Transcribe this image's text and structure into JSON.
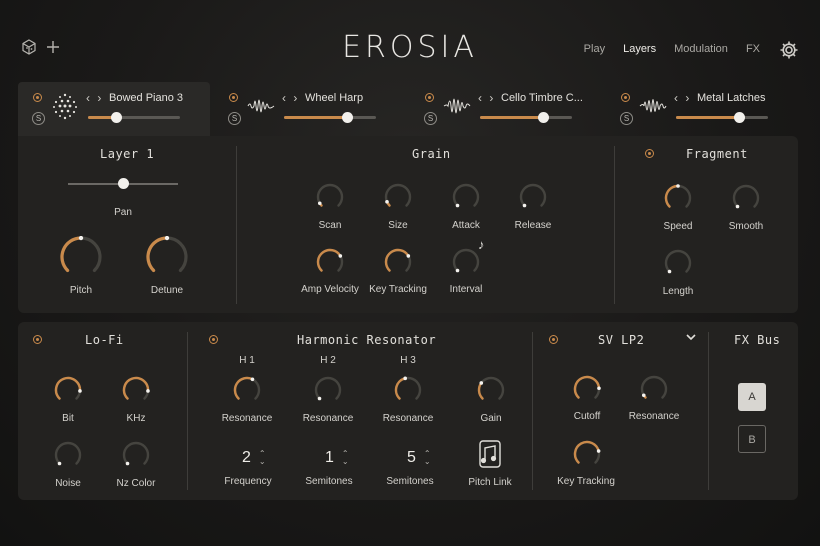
{
  "header": {
    "title": "EROSIA",
    "nav": [
      {
        "label": "Play",
        "active": false
      },
      {
        "label": "Layers",
        "active": true
      },
      {
        "label": "Modulation",
        "active": false
      },
      {
        "label": "FX",
        "active": false
      }
    ]
  },
  "layers": [
    {
      "name": "Bowed Piano 3",
      "level": 0.3,
      "active": true,
      "icon": "dots-sphere-icon"
    },
    {
      "name": "Wheel Harp",
      "level": 0.68,
      "active": false,
      "icon": "waveform-icon"
    },
    {
      "name": "Cello Timbre C...",
      "level": 0.68,
      "active": false,
      "icon": "waveform-icon"
    },
    {
      "name": "Metal Latches",
      "level": 0.68,
      "active": false,
      "icon": "waveform-icon"
    }
  ],
  "solo_label": "S",
  "layer_section": {
    "title": "Layer 1",
    "pan": {
      "label": "Pan",
      "value": 0.5
    },
    "knobs": [
      {
        "label": "Pitch",
        "value": 0.5
      },
      {
        "label": "Detune",
        "value": 0.5
      }
    ]
  },
  "grain": {
    "title": "Grain",
    "knobs": [
      {
        "label": "Scan",
        "value": 0.05
      },
      {
        "label": "Size",
        "value": 0.08
      },
      {
        "label": "Attack",
        "value": 0.0
      },
      {
        "label": "Release",
        "value": 0.0
      },
      {
        "label": "Amp Velocity",
        "value": 0.72
      },
      {
        "label": "Key Tracking",
        "value": 0.72
      },
      {
        "label": "Interval",
        "value": 0.0
      }
    ]
  },
  "fragment": {
    "title": "Fragment",
    "knobs": [
      {
        "label": "Speed",
        "value": 0.5
      },
      {
        "label": "Smooth",
        "value": 0.0
      },
      {
        "label": "Length",
        "value": 0.0
      }
    ]
  },
  "lofi": {
    "title": "Lo-Fi",
    "knobs": [
      {
        "label": "Bit",
        "value": 0.85
      },
      {
        "label": "KHz",
        "value": 0.85
      },
      {
        "label": "Noise",
        "value": 0.0
      },
      {
        "label": "Nz Color",
        "value": 0.0
      }
    ]
  },
  "resonator": {
    "title": "Harmonic Resonator",
    "harmonics": [
      "H 1",
      "H 2",
      "H 3"
    ],
    "knobs": [
      {
        "label": "Resonance",
        "value": 0.6
      },
      {
        "label": "Resonance",
        "value": 0.0
      },
      {
        "label": "Resonance",
        "value": 0.45
      },
      {
        "label": "Gain",
        "value": 0.3
      }
    ],
    "steppers": [
      {
        "label": "Frequency",
        "value": "2"
      },
      {
        "label": "Semitones",
        "value": "1"
      },
      {
        "label": "Semitones",
        "value": "5"
      }
    ],
    "pitch_link": "Pitch Link"
  },
  "filter": {
    "title": "SV LP2",
    "knobs": [
      {
        "label": "Cutoff",
        "value": 0.82
      },
      {
        "label": "Resonance",
        "value": 0.05
      },
      {
        "label": "Key Tracking",
        "value": 0.78
      }
    ]
  },
  "fxbus": {
    "title": "FX Bus",
    "buttons": [
      {
        "label": "A",
        "active": true
      },
      {
        "label": "B",
        "active": false
      }
    ]
  },
  "colors": {
    "accent": "#c98a4b",
    "panel": "#232220",
    "background": "#1a1918"
  }
}
